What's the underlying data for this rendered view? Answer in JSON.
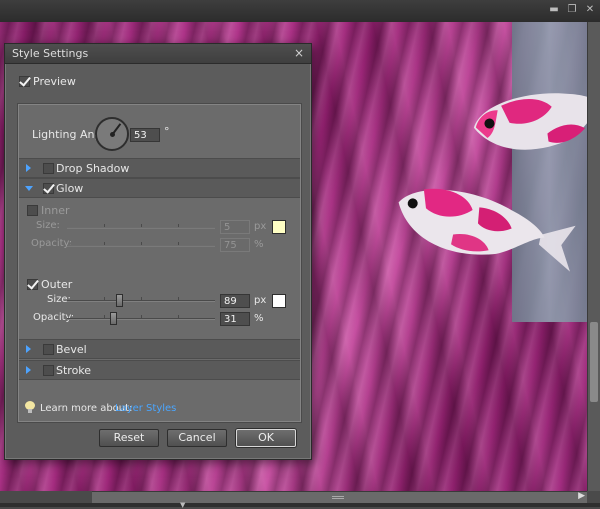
{
  "window": {
    "minimize": "▬",
    "restore": "❐",
    "close": "✕"
  },
  "dialog": {
    "title": "Style Settings",
    "close_glyph": "×",
    "preview": {
      "label": "Preview",
      "checked": true
    },
    "lighting_angle": {
      "label": "Lighting Angle:",
      "value": "53",
      "unit": "°"
    },
    "sections": {
      "drop_shadow": {
        "label": "Drop Shadow",
        "checked": false,
        "expanded": false
      },
      "glow": {
        "label": "Glow",
        "checked": true,
        "expanded": true,
        "inner": {
          "label": "Inner",
          "checked": false,
          "size_label": "Size:",
          "size_value": "5",
          "size_unit": "px",
          "opacity_label": "Opacity:",
          "opacity_value": "75",
          "opacity_unit": "%",
          "swatch_color": "#ffffc4"
        },
        "outer": {
          "label": "Outer",
          "checked": true,
          "size_label": "Size:",
          "size_value": "89",
          "size_unit": "px",
          "size_level": 0.35,
          "opacity_label": "Opacity:",
          "opacity_value": "31",
          "opacity_unit": "%",
          "opacity_level": 0.31,
          "swatch_color": "#ffffff"
        }
      },
      "bevel": {
        "label": "Bevel",
        "checked": false,
        "expanded": false
      },
      "stroke": {
        "label": "Stroke",
        "checked": false,
        "expanded": false
      }
    },
    "learn_more": {
      "label": "Learn more about:",
      "link": "Layer Styles"
    },
    "buttons": {
      "reset": "Reset",
      "cancel": "Cancel",
      "ok": "OK"
    }
  },
  "colors": {
    "accent": "#4da3ff",
    "link": "#4aa6ff"
  }
}
